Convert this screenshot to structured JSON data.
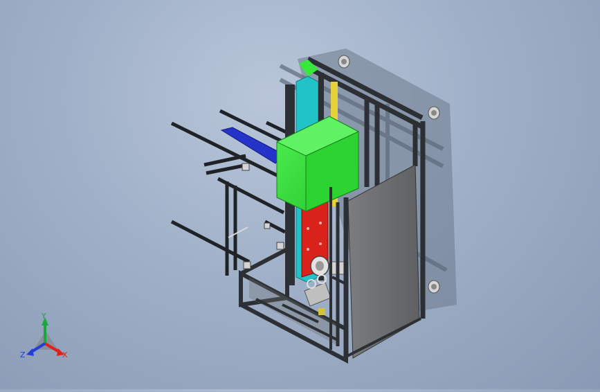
{
  "triad": {
    "x_label": "X",
    "y_label": "Y",
    "z_label": "Z",
    "x_color": "#e0201c",
    "y_color": "#19a83a",
    "z_color": "#1f3fd6"
  },
  "model": {
    "frame_color": "#2c2f33",
    "panel_color": "#6d6e70",
    "green_box_color": "#36e83b",
    "red_plate_color": "#d8221a",
    "blue_bar_color": "#2434c9",
    "cyan_rail_color": "#22c3c8",
    "yellow_strip_color": "#e6d13a"
  }
}
